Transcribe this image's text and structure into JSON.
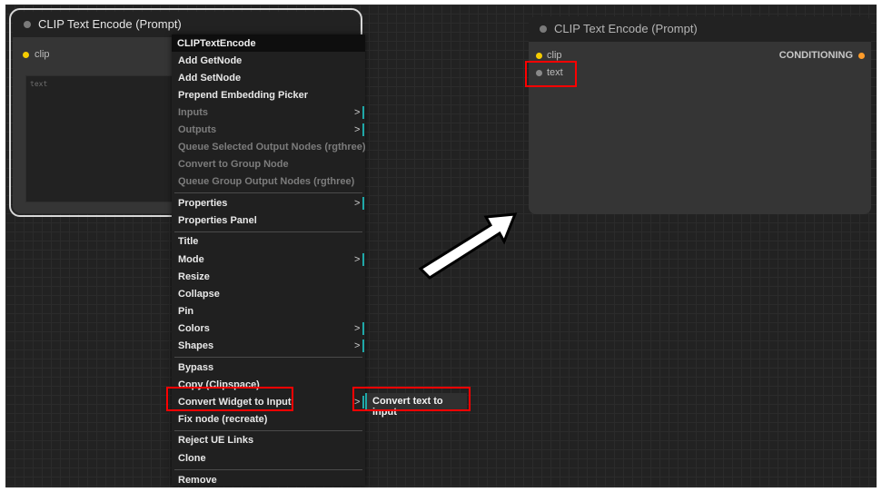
{
  "left_node": {
    "title": "CLIP Text Encode (Prompt)",
    "input_clip": "clip",
    "textarea_placeholder": "text"
  },
  "right_node": {
    "title": "CLIP Text Encode (Prompt)",
    "input_clip": "clip",
    "input_text": "text",
    "output": "CONDITIONING"
  },
  "context_menu": {
    "header": "CLIPTextEncode",
    "items": [
      {
        "label": "Add GetNode"
      },
      {
        "label": "Add SetNode"
      },
      {
        "label": "Prepend Embedding Picker"
      },
      {
        "label": "Inputs"
      },
      {
        "label": "Outputs"
      },
      {
        "label": "Queue Selected Output Nodes (rgthree)"
      },
      {
        "label": "Convert to Group Node"
      },
      {
        "label": "Queue Group Output Nodes (rgthree)"
      },
      {
        "label": "Properties"
      },
      {
        "label": "Properties Panel"
      },
      {
        "label": "Title"
      },
      {
        "label": "Mode"
      },
      {
        "label": "Resize"
      },
      {
        "label": "Collapse"
      },
      {
        "label": "Pin"
      },
      {
        "label": "Colors"
      },
      {
        "label": "Shapes"
      },
      {
        "label": "Bypass"
      },
      {
        "label": "Copy (Clipspace)"
      },
      {
        "label": "Convert Widget to Input"
      },
      {
        "label": "Fix node (recreate)"
      },
      {
        "label": "Reject UE Links"
      },
      {
        "label": "Clone"
      },
      {
        "label": "Remove"
      }
    ],
    "submenu_arrow": ">"
  },
  "submenu": {
    "item": "Convert text to input"
  },
  "colors": {
    "highlight": "#ff0000",
    "slot_yellow": "#f5cc00",
    "accent_teal": "#1fa8a8"
  }
}
